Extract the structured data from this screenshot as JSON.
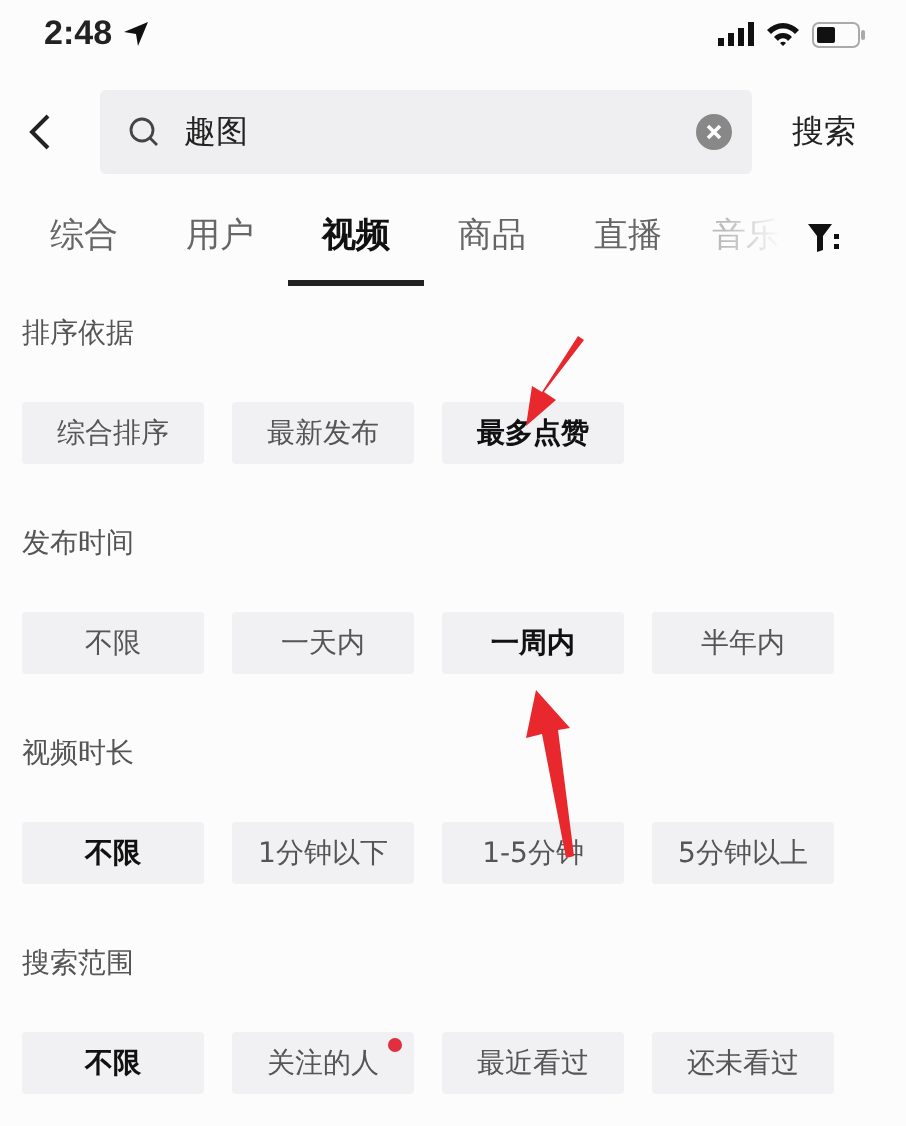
{
  "status_bar": {
    "time": "2:48"
  },
  "search": {
    "value": "趣图",
    "action": "搜索"
  },
  "tabs": [
    {
      "label": "综合",
      "selected": false
    },
    {
      "label": "用户",
      "selected": false
    },
    {
      "label": "视频",
      "selected": true
    },
    {
      "label": "商品",
      "selected": false
    },
    {
      "label": "直播",
      "selected": false
    },
    {
      "label": "音乐",
      "selected": false
    }
  ],
  "filters": [
    {
      "title": "排序依据",
      "options": [
        {
          "label": "综合排序",
          "selected": false
        },
        {
          "label": "最新发布",
          "selected": false
        },
        {
          "label": "最多点赞",
          "selected": true
        }
      ]
    },
    {
      "title": "发布时间",
      "options": [
        {
          "label": "不限",
          "selected": false
        },
        {
          "label": "一天内",
          "selected": false
        },
        {
          "label": "一周内",
          "selected": true
        },
        {
          "label": "半年内",
          "selected": false
        }
      ]
    },
    {
      "title": "视频时长",
      "options": [
        {
          "label": "不限",
          "selected": true
        },
        {
          "label": "1分钟以下",
          "selected": false
        },
        {
          "label": "1-5分钟",
          "selected": false
        },
        {
          "label": "5分钟以上",
          "selected": false
        }
      ]
    },
    {
      "title": "搜索范围",
      "options": [
        {
          "label": "不限",
          "selected": true
        },
        {
          "label": "关注的人",
          "selected": false,
          "badge": true
        },
        {
          "label": "最近看过",
          "selected": false
        },
        {
          "label": "还未看过",
          "selected": false
        }
      ]
    }
  ]
}
